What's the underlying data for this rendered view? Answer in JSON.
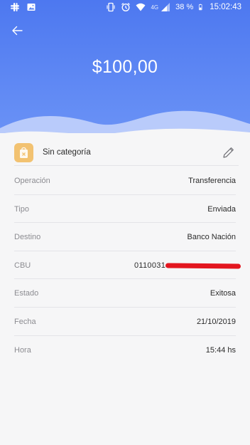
{
  "status_bar": {
    "network_label": "4G",
    "battery": "38 %",
    "time": "15:02:43",
    "icons": [
      "slack-icon",
      "image-icon",
      "vibrate-icon",
      "alarm-icon",
      "wifi-icon",
      "signal-icon",
      "battery-icon"
    ]
  },
  "header": {
    "back_icon": "arrow-left-icon",
    "amount": "$100,00",
    "gradient_top": "#4d78f0",
    "gradient_bottom": "#6b93f6"
  },
  "category": {
    "label": "Sin categoría",
    "icon": "uncategorized-bag-icon",
    "icon_color": "#f2c271",
    "edit_icon": "pencil-icon"
  },
  "details": [
    {
      "label": "Operación",
      "value": "Transferencia"
    },
    {
      "label": "Tipo",
      "value": "Enviada"
    },
    {
      "label": "Destino",
      "value": "Banco Nación"
    },
    {
      "label": "CBU",
      "value": "0110031"
    },
    {
      "label": "Estado",
      "value": "Exitosa"
    },
    {
      "label": "Fecha",
      "value": "21/10/2019"
    },
    {
      "label": "Hora",
      "value": "15:44 hs"
    }
  ],
  "redaction_color": "#e3161f"
}
